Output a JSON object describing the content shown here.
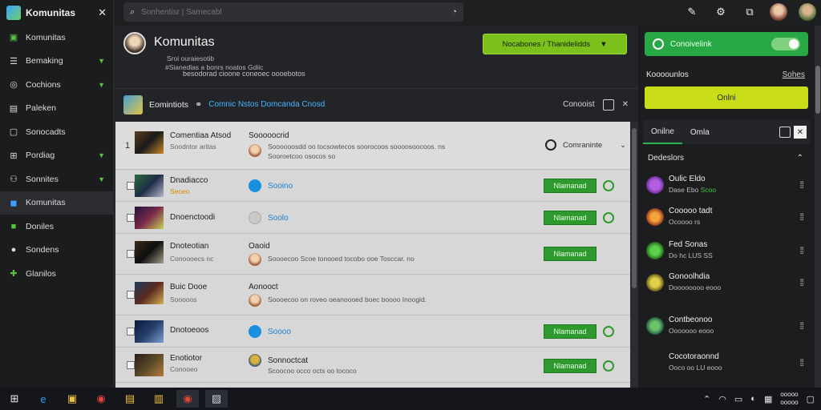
{
  "sidebar": {
    "app_name": "Komunitas",
    "items": [
      {
        "label": "Komunitas",
        "icon": "gamepad-icon",
        "chev": false
      },
      {
        "label": "Bemaking",
        "icon": "list-icon",
        "chev": true
      },
      {
        "label": "Cochions",
        "icon": "globe-icon",
        "chev": true
      },
      {
        "label": "Paleken",
        "icon": "bookmark-icon",
        "chev": false
      },
      {
        "label": "Sonocadts",
        "icon": "chat-icon",
        "chev": false
      },
      {
        "label": "Pordiag",
        "icon": "grid-icon",
        "chev": true
      },
      {
        "label": "Sonnites",
        "icon": "people-icon",
        "chev": true
      },
      {
        "label": "Komunitas",
        "icon": "community-icon",
        "chev": false
      },
      {
        "label": "Doniles",
        "icon": "square-icon",
        "chev": false
      },
      {
        "label": "Sondens",
        "icon": "circle-icon",
        "chev": false
      },
      {
        "label": "Glanilos",
        "icon": "puzzle-icon",
        "chev": false
      }
    ]
  },
  "search": {
    "placeholder": "Sonhentisr | Samecabl"
  },
  "profile": {
    "title": "Komunitas",
    "sub1": "Sroi ouraiesotib",
    "sub2": "#Sianedlas a bonrs noatos Gdiic",
    "sub3": "besodorad cioone coneoec oooebotos",
    "select_label": "Nocabones / Thanidelidds"
  },
  "subhead": {
    "title": "Eomintiots",
    "link": "Comnic Nstos Domcanda Cnosd",
    "right_label": "Conooist"
  },
  "rows": [
    {
      "name": "Comentiaa Atsod",
      "sub": "Soodntor aritas",
      "mid": "Sooooocrid",
      "desc": "Soooooosdd oo tocsowtecos soorocoos soooosoocoos. ns",
      "desc2": "Sooroetcoo osocos so",
      "action": "Comraninte"
    },
    {
      "name": "Dnadiacco",
      "sub": "Seoeo",
      "mid": "Sooino",
      "action": "Nlamanad"
    },
    {
      "name": "Dnoenctoodi",
      "sub": "",
      "mid": "Soolo",
      "action": "Nlamanad"
    },
    {
      "name": "Dnoteotian",
      "sub": "Conoooecs nc",
      "mid": "Oaoid",
      "desc": "Soooecoo Scoe tonooed tocobo ooe Tosccar. no",
      "action": "Nlamanad"
    },
    {
      "name": "Buic Dooe",
      "sub": "Sooooos",
      "mid": "Aonooct",
      "desc": "Soooecoo on roveo oeanoooed boec boooo Inoogid.",
      "action": "Nlamanad"
    },
    {
      "name": "Dnotoeoos",
      "sub": "",
      "mid": "Soooo",
      "action": "Nlamanad"
    },
    {
      "name": "Enotiotor",
      "sub": "Conooeo",
      "mid": "Sonnoctcat",
      "desc": "Scoocoo occo octs oo tococo",
      "action": "Nlamanad"
    }
  ],
  "right": {
    "toggle_label": "Conoivelink",
    "head_left": "Koooounlos",
    "head_right": "Sohes",
    "yellow_btn": "Onlni",
    "tabs": [
      "Onilne",
      "Omla"
    ],
    "section_title": "Dedeslors",
    "friends": [
      {
        "name": "Oulic Eldo",
        "sub": "Dase Ebo",
        "status": "Scoo"
      },
      {
        "name": "Cooooo tadt",
        "sub": "Ocoooo rs",
        "status": ""
      },
      {
        "name": "Fed Sonas",
        "sub": "Do hc LUS SS",
        "status": ""
      },
      {
        "name": "Gonoolhdia",
        "sub": "Doooooooo eooo",
        "status": ""
      },
      {
        "name": "Contbeonoo",
        "sub": "Ooooooo eooo",
        "status": ""
      },
      {
        "name": "Cocotoraonnd",
        "sub": "Ooco oo LU eooo",
        "status": ""
      }
    ]
  },
  "taskbar": {
    "time": "ooooo",
    "date": "ooooo"
  }
}
